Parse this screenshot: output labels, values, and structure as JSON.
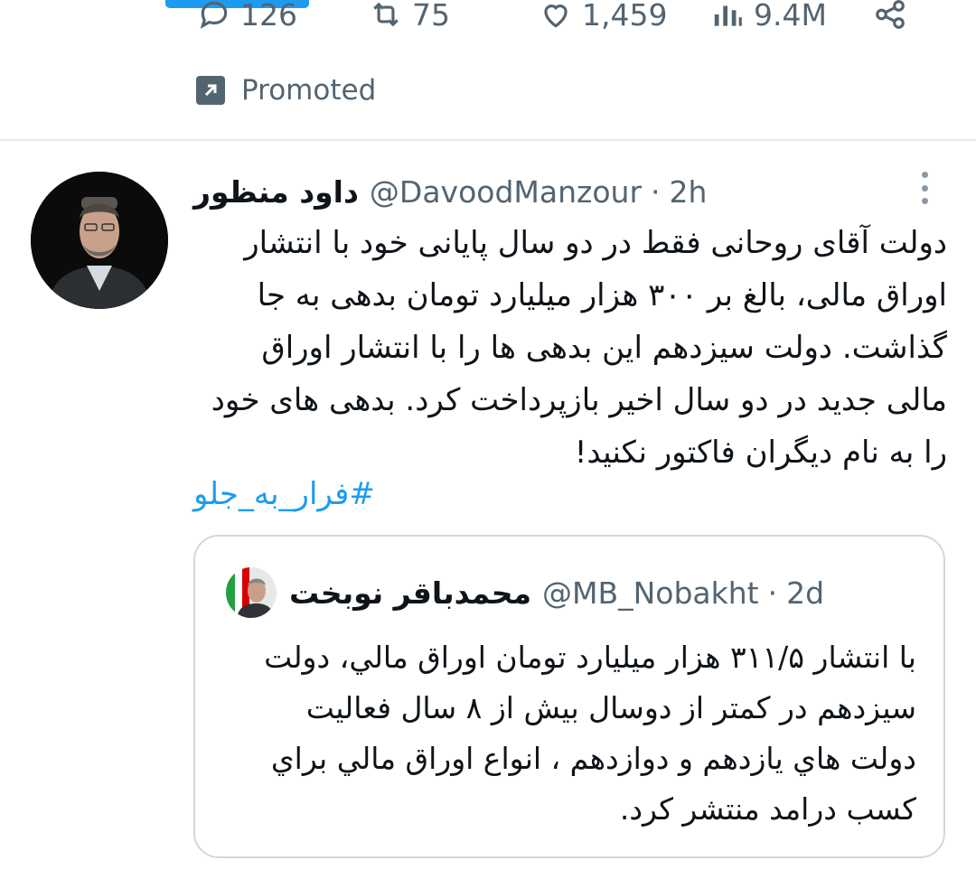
{
  "action_bar": {
    "replies": "126",
    "retweets": "75",
    "likes": "1,459",
    "views": "9.4M"
  },
  "promoted_label": "Promoted",
  "tweet": {
    "display_name": "داود منظور",
    "handle": "@DavoodManzour",
    "separator": "·",
    "time": "2h",
    "text": "دولت آقای روحانی فقط در دو سال پایانی خود با انتشار اوراق مالی، بالغ بر ۳۰۰ هزار میلیارد تومان بدهی به جا گذاشت. دولت سیزدهم این بدهی ها را با انتشار اوراق مالی جدید در دو سال اخیر بازپرداخت کرد. بدهی های خود را به نام دیگران فاکتور نکنید!",
    "hashtag": "#فرار_به_جلو"
  },
  "quoted": {
    "display_name": "محمدباقر نوبخت",
    "handle": "@MB_Nobakht",
    "separator": "·",
    "time": "2d",
    "text": "با انتشار ۳۱۱/۵ هزار ميليارد تومان اوراق مالي، دولت سيزدهم در كمتر از دوسال بيش از ۸ سال فعاليت دولت هاي يازدهم و دوازدهم ، انواع اوراق مالي براي كسب درامد منتشر كرد."
  },
  "icons": {
    "reply": "reply-icon",
    "retweet": "retweet-icon",
    "like": "heart-icon",
    "views": "views-icon",
    "share": "share-icon",
    "promoted": "promoted-arrow-icon",
    "more": "more-options-icon"
  },
  "colors": {
    "accent": "#1d9bf0",
    "secondary_text": "#536471",
    "border": "#cfd9de"
  }
}
